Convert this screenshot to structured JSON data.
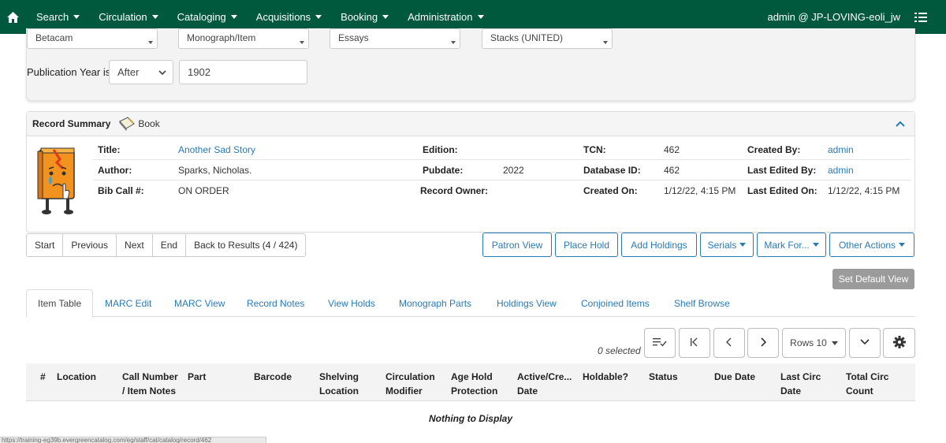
{
  "nav": {
    "menus": [
      "Search",
      "Circulation",
      "Cataloging",
      "Acquisitions",
      "Booking",
      "Administration"
    ],
    "user": "admin @ JP-LOVING-eoli_jw"
  },
  "search": {
    "filters": [
      "Betacam",
      "Monograph/Item",
      "Essays",
      "Stacks (UNITED)"
    ],
    "pub_year_label": "Publication Year is",
    "pub_year_op": "After",
    "pub_year_value": "1902"
  },
  "record": {
    "header": "Record Summary",
    "format": "Book",
    "fields": {
      "title_label": "Title:",
      "title": "Another Sad Story",
      "author_label": "Author:",
      "author": "Sparks, Nicholas.",
      "callnum_label": "Bib Call #:",
      "callnum": "ON ORDER",
      "edition_label": "Edition:",
      "edition": "",
      "pubdate_label": "Pubdate:",
      "pubdate": "2022",
      "owner_label": "Record Owner:",
      "owner": "",
      "tcn_label": "TCN:",
      "tcn": "462",
      "dbid_label": "Database ID:",
      "dbid": "462",
      "created_on_label": "Created On:",
      "created_on": "1/12/22, 4:15 PM",
      "created_by_label": "Created By:",
      "created_by": "admin",
      "edited_by_label": "Last Edited By:",
      "edited_by": "admin",
      "edited_on_label": "Last Edited On:",
      "edited_on": "1/12/22, 4:15 PM"
    }
  },
  "pager": {
    "start": "Start",
    "previous": "Previous",
    "next": "Next",
    "end": "End",
    "back": "Back to Results (4 / 424)"
  },
  "actions": {
    "patron_view": "Patron View",
    "place_hold": "Place Hold",
    "add_holdings": "Add Holdings",
    "serials": "Serials",
    "mark_for": "Mark For...",
    "other_actions": "Other Actions",
    "set_default_view": "Set Default View"
  },
  "tabs": [
    "Item Table",
    "MARC Edit",
    "MARC View",
    "Record Notes",
    "View Holds",
    "Monograph Parts",
    "Holdings View",
    "Conjoined Items",
    "Shelf Browse"
  ],
  "grid": {
    "selected": "0 selected",
    "rows_label": "Rows 10",
    "columns": [
      [
        "#"
      ],
      [
        "Location"
      ],
      [
        "Call Number",
        "/ Item Notes"
      ],
      [
        "Part"
      ],
      [
        "Barcode"
      ],
      [
        "Shelving",
        "Location"
      ],
      [
        "Circulation",
        "Modifier"
      ],
      [
        "Age Hold",
        "Protection"
      ],
      [
        "Active/Cre...",
        "Date"
      ],
      [
        "Holdable?"
      ],
      [
        "Status"
      ],
      [
        "Due Date"
      ],
      [
        "Last Circ",
        "Date"
      ],
      [
        "Total Circ",
        "Count"
      ]
    ],
    "empty": "Nothing to Display"
  },
  "status_url": "https://training-eg39b.evergreencatalog.com/eg/staff/cat/catalog/record/462",
  "colors": {
    "navbar": "#00593d",
    "link": "#2a7ab6",
    "disabled": "#9b9b9b"
  }
}
